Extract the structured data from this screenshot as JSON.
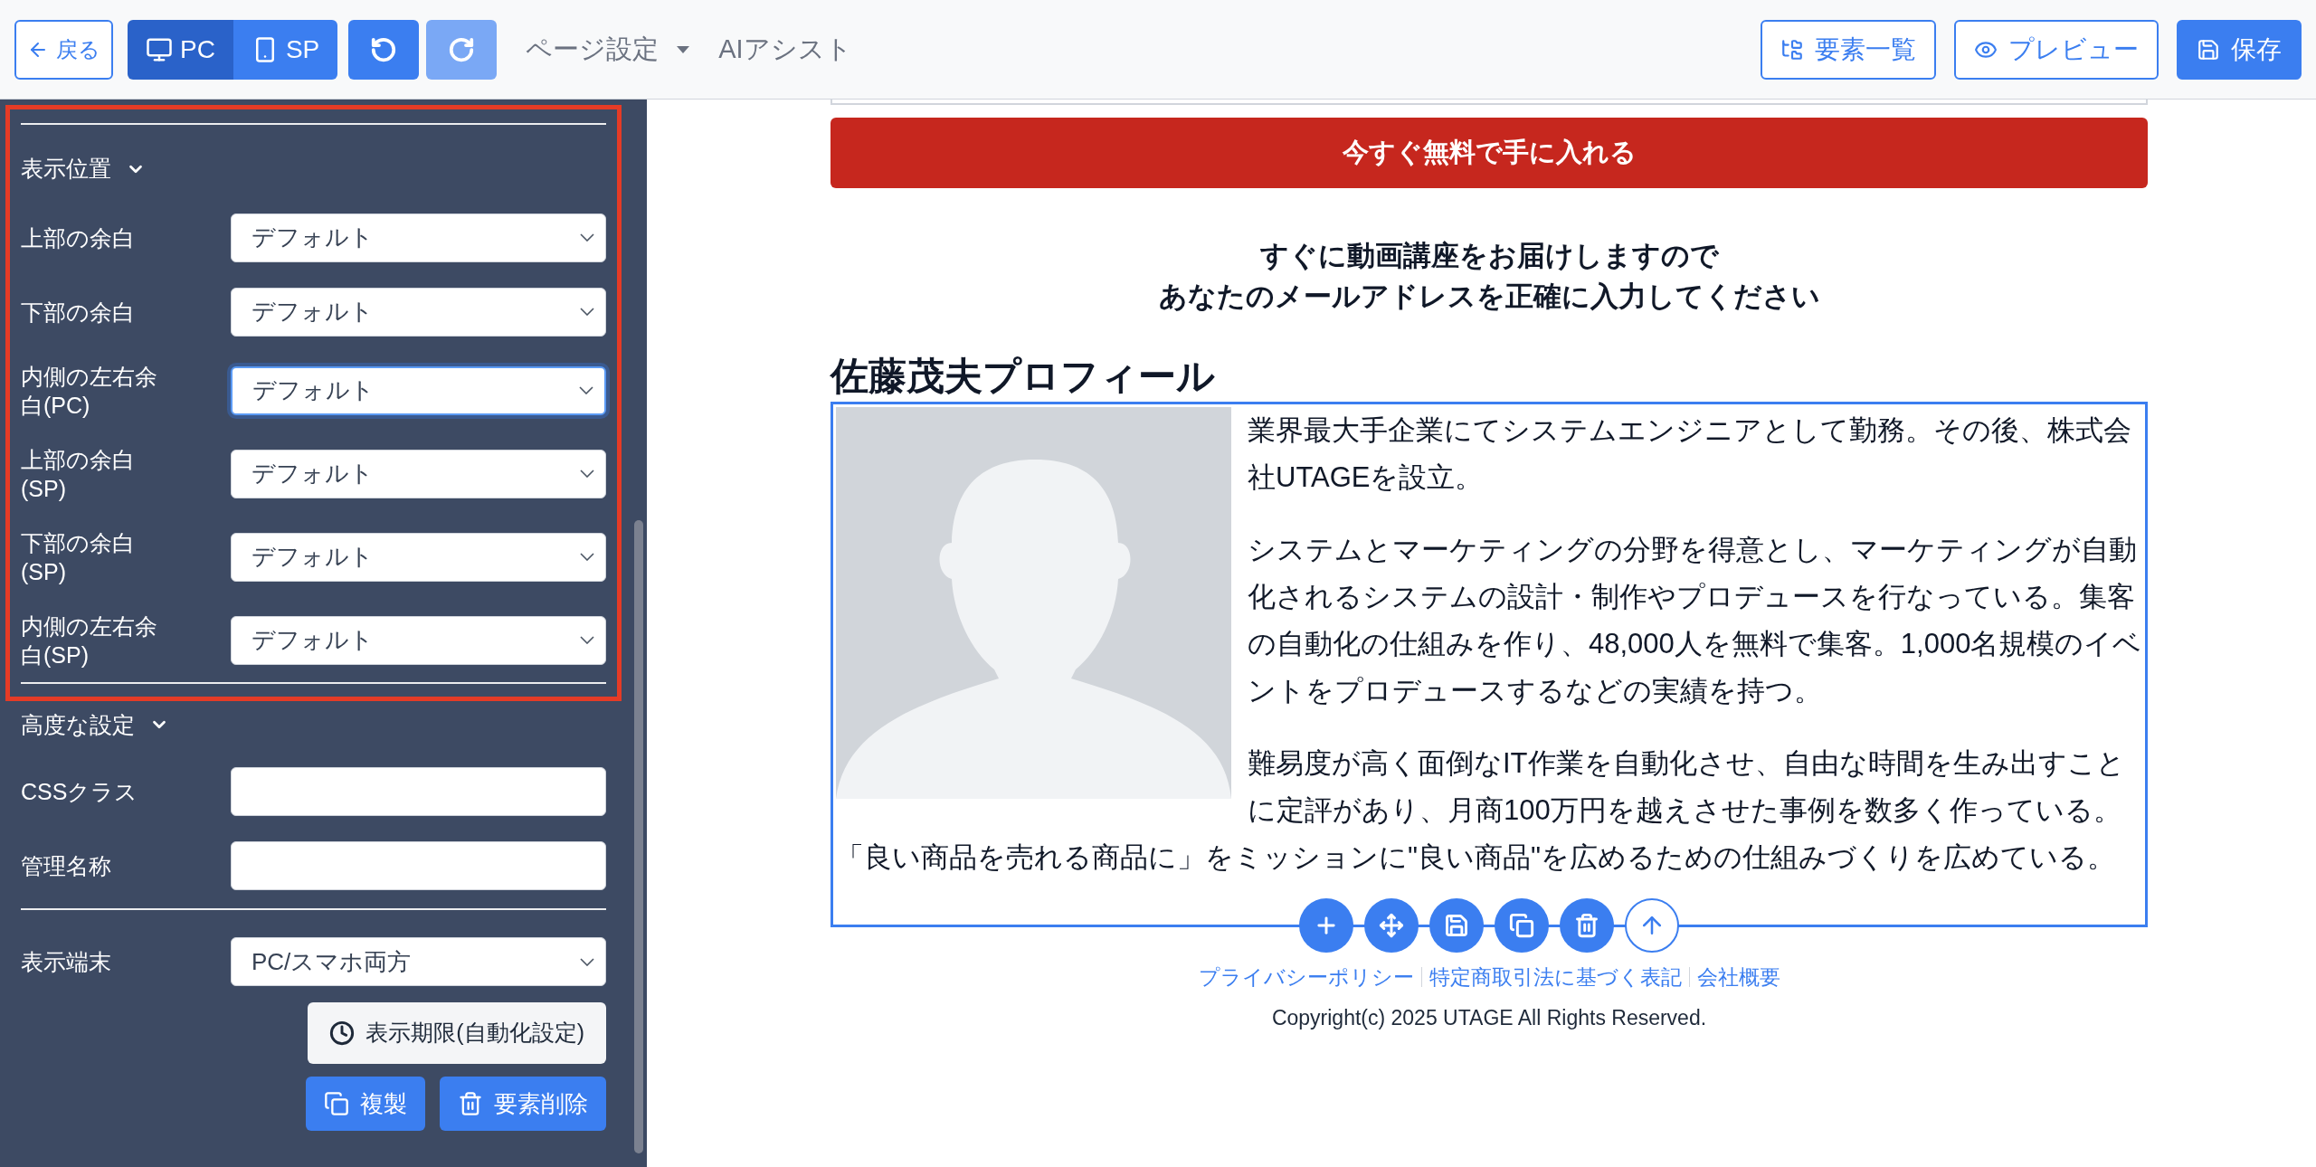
{
  "toolbar": {
    "back": "戻る",
    "devices": [
      {
        "label": "PC",
        "kind": "desktop",
        "selected": true
      },
      {
        "label": "SP",
        "kind": "phone",
        "selected": false
      }
    ],
    "undo": {
      "disabled": false
    },
    "redo": {
      "disabled": true
    },
    "menus": [
      {
        "label": "ページ設定",
        "dropdown": true
      },
      {
        "label": "AIアシスト",
        "dropdown": false
      }
    ],
    "actions": [
      {
        "label": "要素一覧",
        "kind": "tree",
        "primary": false
      },
      {
        "label": "プレビュー",
        "kind": "eye",
        "primary": false
      },
      {
        "label": "保存",
        "kind": "save",
        "primary": true
      }
    ]
  },
  "sidebar": {
    "sections": [
      {
        "title": "表示位置",
        "expanded": true,
        "highlighted": true,
        "fields": [
          {
            "label": "上部の余白",
            "kind": "select",
            "value": "デフォルト",
            "focused": false
          },
          {
            "label": "下部の余白",
            "kind": "select",
            "value": "デフォルト",
            "focused": false
          },
          {
            "label": "内側の左右余白(PC)",
            "kind": "select",
            "value": "デフォルト",
            "focused": true
          },
          {
            "label": "上部の余白(SP)",
            "kind": "select",
            "value": "デフォルト",
            "focused": false
          },
          {
            "label": "下部の余白(SP)",
            "kind": "select",
            "value": "デフォルト",
            "focused": false
          },
          {
            "label": "内側の左右余白(SP)",
            "kind": "select",
            "value": "デフォルト",
            "focused": false
          }
        ]
      },
      {
        "title": "高度な設定",
        "expanded": true,
        "highlighted": false,
        "fields": [
          {
            "label": "CSSクラス",
            "kind": "text",
            "focused": false
          },
          {
            "label": "管理名称",
            "kind": "text",
            "focused": false
          }
        ]
      }
    ],
    "device_field": {
      "label": "表示端末",
      "value": "PC/スマホ両方"
    },
    "schedule_button": "表示期限(自動化設定)",
    "buttons": [
      {
        "label": "複製",
        "kind": "copy"
      },
      {
        "label": "要素削除",
        "kind": "trash"
      }
    ]
  },
  "page": {
    "cta_button": "今すぐ無料で手に入れる",
    "notice": [
      "すぐに動画講座をお届けしますので",
      "あなたのメールアドレスを正確に入力してください"
    ],
    "profile": {
      "title": "佐藤茂夫プロフィール",
      "selected": true,
      "paragraphs": [
        "業界最大手企業にてシステムエンジニアとして勤務。その後、株式会社UTAGEを設立。",
        "システムとマーケティングの分野を得意とし、マーケティングが自動化されるシステムの設計・制作やプロデュースを行なっている。集客の自動化の仕組みを作り、48,000人を無料で集客。1,000名規模のイベントをプロデュースするなどの実績を持つ。",
        "難易度が高く面倒なIT作業を自動化させ、自由な時間を生み出すことに定評があり、月商100万円を越えさせた事例を数多く作っている。「良い商品を売れる商品に」をミッションに\"良い商品\"を広めるための仕組みづくりを広めている。"
      ]
    },
    "footer_links": [
      "プライバシーポリシー",
      "特定商取引法に基づく表記",
      "会社概要"
    ],
    "copyright": "Copyright(c) 2025 UTAGE All Rights Reserved."
  }
}
